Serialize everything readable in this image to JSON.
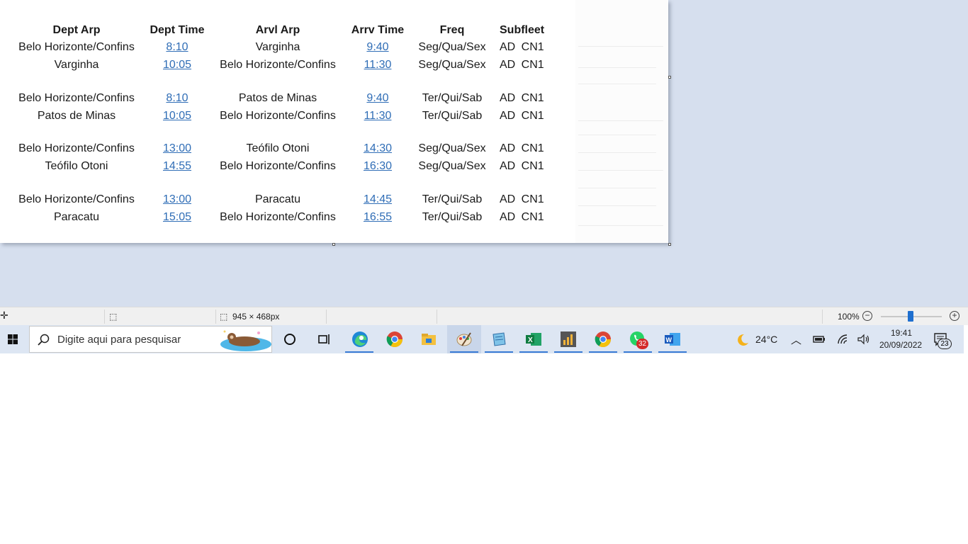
{
  "table": {
    "headers": [
      "Dept Arp",
      "Dept Time",
      "Arvl Arp",
      "Arrv Time",
      "Freq",
      "Subfleet"
    ],
    "rows": [
      {
        "dep": "Belo Horizonte/Confins",
        "dep_time": "8:10",
        "arr": "Varginha",
        "arr_time": "9:40",
        "freq": "Seg/Qua/Sex",
        "fleet": "AD  CN1"
      },
      {
        "dep": "Varginha",
        "dep_time": "10:05",
        "arr": "Belo Horizonte/Confins",
        "arr_time": "11:30",
        "freq": "Seg/Qua/Sex",
        "fleet": "AD  CN1"
      },
      {
        "dep": "Belo Horizonte/Confins",
        "dep_time": "8:10",
        "arr": "Patos de Minas",
        "arr_time": "9:40",
        "freq": "Ter/Qui/Sab",
        "fleet": "AD  CN1"
      },
      {
        "dep": "Patos de Minas",
        "dep_time": "10:05",
        "arr": "Belo Horizonte/Confins",
        "arr_time": "11:30",
        "freq": "Ter/Qui/Sab",
        "fleet": "AD  CN1"
      },
      {
        "dep": "Belo Horizonte/Confins",
        "dep_time": "13:00",
        "arr": "Teófilo Otoni",
        "arr_time": "14:30",
        "freq": "Seg/Qua/Sex",
        "fleet": "AD  CN1"
      },
      {
        "dep": "Teófilo Otoni",
        "dep_time": "14:55",
        "arr": "Belo Horizonte/Confins",
        "arr_time": "16:30",
        "freq": "Seg/Qua/Sex",
        "fleet": "AD  CN1"
      },
      {
        "dep": "Belo Horizonte/Confins",
        "dep_time": "13:00",
        "arr": "Paracatu",
        "arr_time": "14:45",
        "freq": "Ter/Qui/Sab",
        "fleet": "AD  CN1"
      },
      {
        "dep": "Paracatu",
        "dep_time": "15:05",
        "arr": "Belo Horizonte/Confins",
        "arr_time": "16:55",
        "freq": "Ter/Qui/Sab",
        "fleet": "AD  CN1"
      }
    ]
  },
  "statusbar": {
    "image_size": "945 × 468px",
    "zoom": "100%"
  },
  "taskbar": {
    "search_placeholder": "Digite aqui para pesquisar",
    "weather": "24°C",
    "time": "19:41",
    "date": "20/09/2022",
    "whatsapp_badge": "32",
    "notification_count": "23"
  }
}
